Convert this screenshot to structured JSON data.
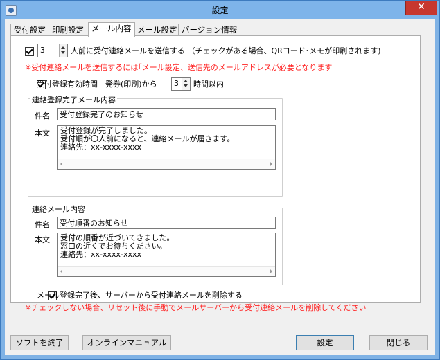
{
  "window": {
    "title": "設定",
    "close_glyph": "✕"
  },
  "tabs": [
    {
      "label": "受付設定",
      "active": false
    },
    {
      "label": "印刷設定",
      "active": false
    },
    {
      "label": "メール内容",
      "active": true
    },
    {
      "label": "メール設定",
      "active": false
    },
    {
      "label": "バージョン情報",
      "active": false
    }
  ],
  "notify": {
    "enabled": true,
    "count": "3",
    "label": "人前に受付連絡メールを送信する （チェックがある場合、QRコード･メモが印刷されます)",
    "warning": "※受付連絡メールを送信するには｢メール設定、送信先のメールアドレスが必要となります"
  },
  "validity": {
    "enabled": true,
    "label_before": "受付登録有効時間　発券(印刷)から",
    "hours": "3",
    "label_after": "時間以内"
  },
  "complete_mail": {
    "group_title": "連絡登録完了メール内容",
    "subject_label": "件名",
    "subject": "受付登録完了のお知らせ",
    "body_label": "本文",
    "body_lines": [
      "受付登録が完了しました。",
      "受付順が〇人前になると、連絡メールが届きます。",
      "連絡先：xx-xxxx-xxxx"
    ]
  },
  "contact_mail": {
    "group_title": "連絡メール内容",
    "subject_label": "件名",
    "subject": "受付順番のお知らせ",
    "body_label": "本文",
    "body_lines": [
      "受付の順番が近づいてきました。",
      "窓口の近くでお待ちください。",
      "連絡先：xx-xxxx-xxxx"
    ]
  },
  "delete": {
    "enabled": true,
    "label": "メール登録完了後、サーバーから受付連絡メールを削除する",
    "warning": "※チェックしない場合、リセット後に手動でメールサーバーから受付連絡メールを削除してください"
  },
  "buttons": {
    "exit": "ソフトを終了",
    "manual": "オンラインマニュアル",
    "settings": "設定",
    "close": "閉じる"
  }
}
